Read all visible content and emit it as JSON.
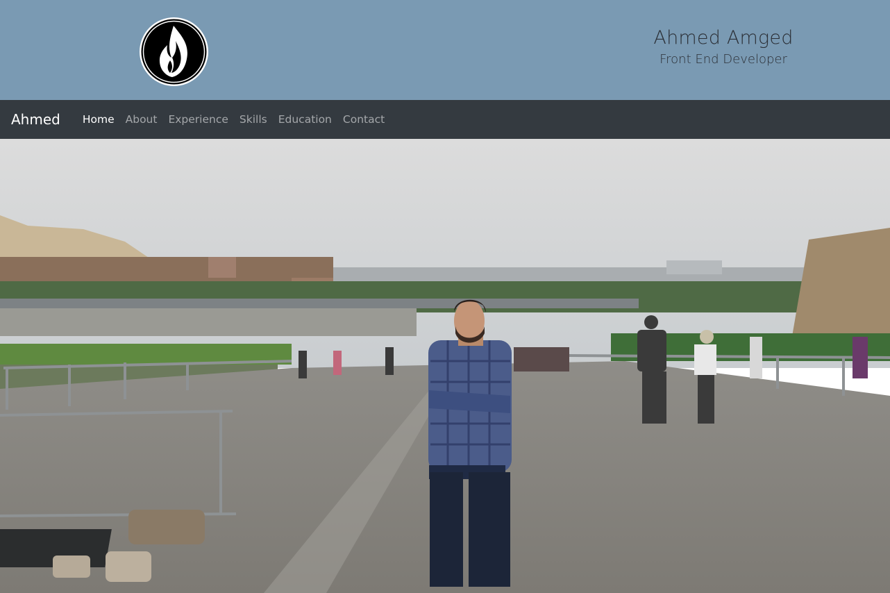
{
  "header": {
    "logo_icon": "flame-icon",
    "name": "Ahmed Amged",
    "title": "Front End Developer"
  },
  "navbar": {
    "brand": "Ahmed",
    "items": [
      {
        "label": "Home",
        "active": true
      },
      {
        "label": "About",
        "active": false
      },
      {
        "label": "Experience",
        "active": false
      },
      {
        "label": "Skills",
        "active": false
      },
      {
        "label": "Education",
        "active": false
      },
      {
        "label": "Contact",
        "active": false
      }
    ]
  },
  "hero": {
    "image": "profile-photo"
  },
  "colors": {
    "header_bg": "#7a9ab3",
    "navbar_bg": "#343a40",
    "nav_active": "#ffffff",
    "nav_inactive": "rgba(255,255,255,0.55)"
  }
}
